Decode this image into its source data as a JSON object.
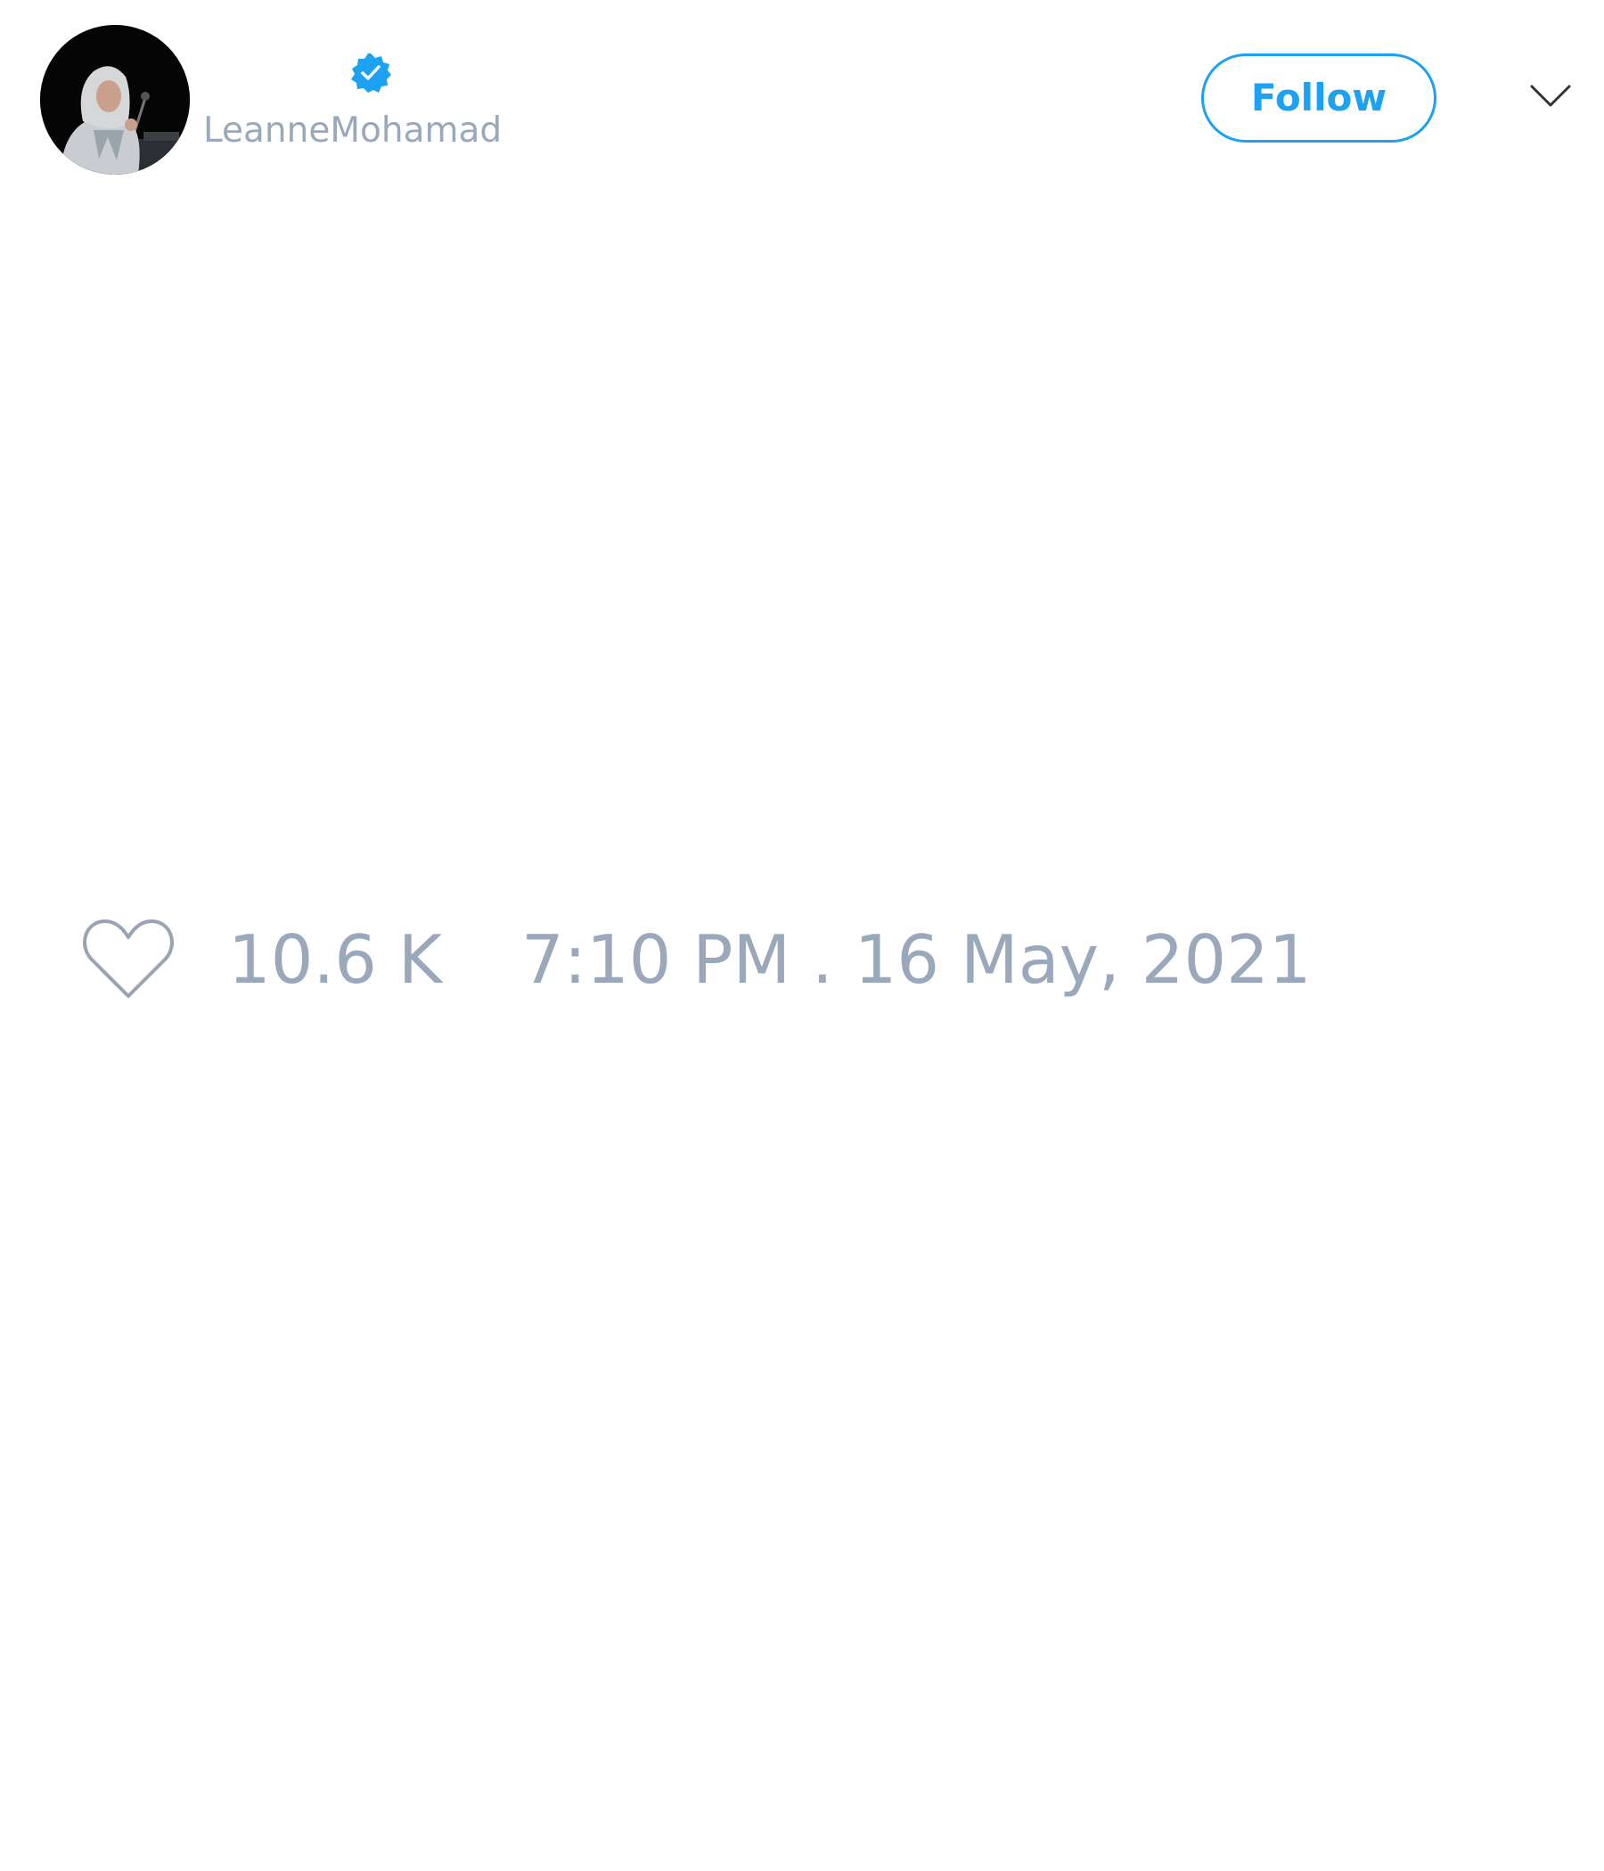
{
  "tweet": {
    "author": {
      "handle": "LeanneMohamad",
      "verified": true
    },
    "follow_button_label": "Follow",
    "menu_icon": "chevron-down-icon",
    "likes": {
      "icon": "heart-icon",
      "count": "10.6 K"
    },
    "timestamp": "7:10 PM . 16 May, 2021"
  },
  "colors": {
    "accent": "#1da1f2",
    "muted_text": "#9aa8bb",
    "icon_stroke": "#98a4b4",
    "chevron": "#333333",
    "background": "#ffffff"
  }
}
